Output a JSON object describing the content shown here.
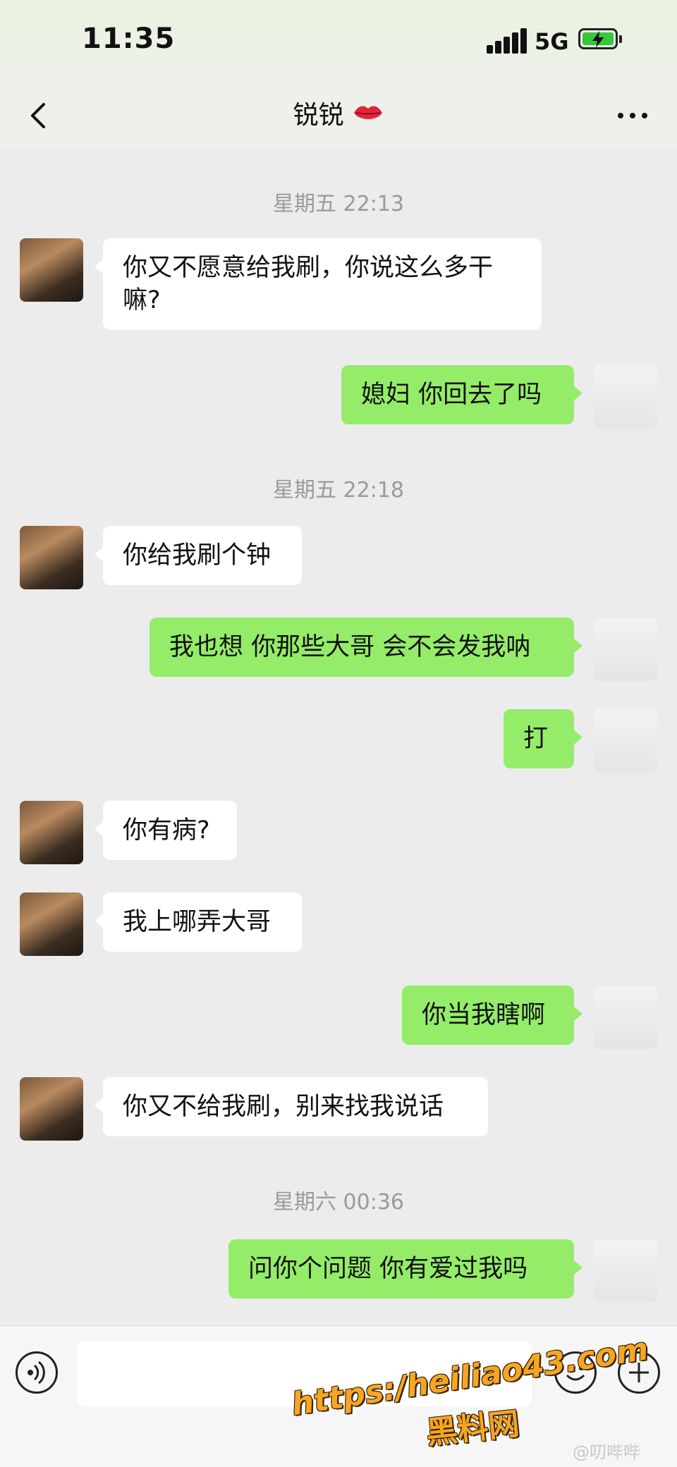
{
  "status_bar": {
    "time": "11:35",
    "network": "5G"
  },
  "header": {
    "title": "锐锐",
    "title_emoji": "lips-icon",
    "back_icon": "chevron-left-icon",
    "more_icon": "more-icon"
  },
  "messages": [
    {
      "type": "timestamp",
      "text": "星期五 22:13"
    },
    {
      "type": "message",
      "from": "her",
      "text": "你又不愿意给我刷，你说这么多干嘛?"
    },
    {
      "type": "message",
      "from": "me",
      "text": "媳妇 你回去了吗"
    },
    {
      "type": "timestamp",
      "text": "星期五 22:18"
    },
    {
      "type": "message",
      "from": "her",
      "text": "你给我刷个钟"
    },
    {
      "type": "message",
      "from": "me",
      "text": "我也想 你那些大哥 会不会发我呐"
    },
    {
      "type": "message",
      "from": "me",
      "text": "打"
    },
    {
      "type": "message",
      "from": "her",
      "text": "你有病?"
    },
    {
      "type": "message",
      "from": "her",
      "text": "我上哪弄大哥"
    },
    {
      "type": "message",
      "from": "me",
      "text": "你当我瞎啊"
    },
    {
      "type": "message",
      "from": "her",
      "text": "你又不给我刷，别来找我说话"
    },
    {
      "type": "timestamp",
      "text": "星期六 00:36"
    },
    {
      "type": "message",
      "from": "me",
      "text": "问你个问题 你有爱过我吗"
    }
  ],
  "input_bar": {
    "voice_icon": "voice-icon",
    "emoji_icon": "emoji-icon",
    "plus_icon": "plus-icon",
    "placeholder": ""
  },
  "watermark": {
    "url": "https:/heiliao43.com",
    "name": "黑料网",
    "weibo": "@叨哔哔"
  },
  "colors": {
    "sent_bubble": "#95ec69",
    "received_bubble": "#ffffff",
    "background": "#ececec"
  }
}
